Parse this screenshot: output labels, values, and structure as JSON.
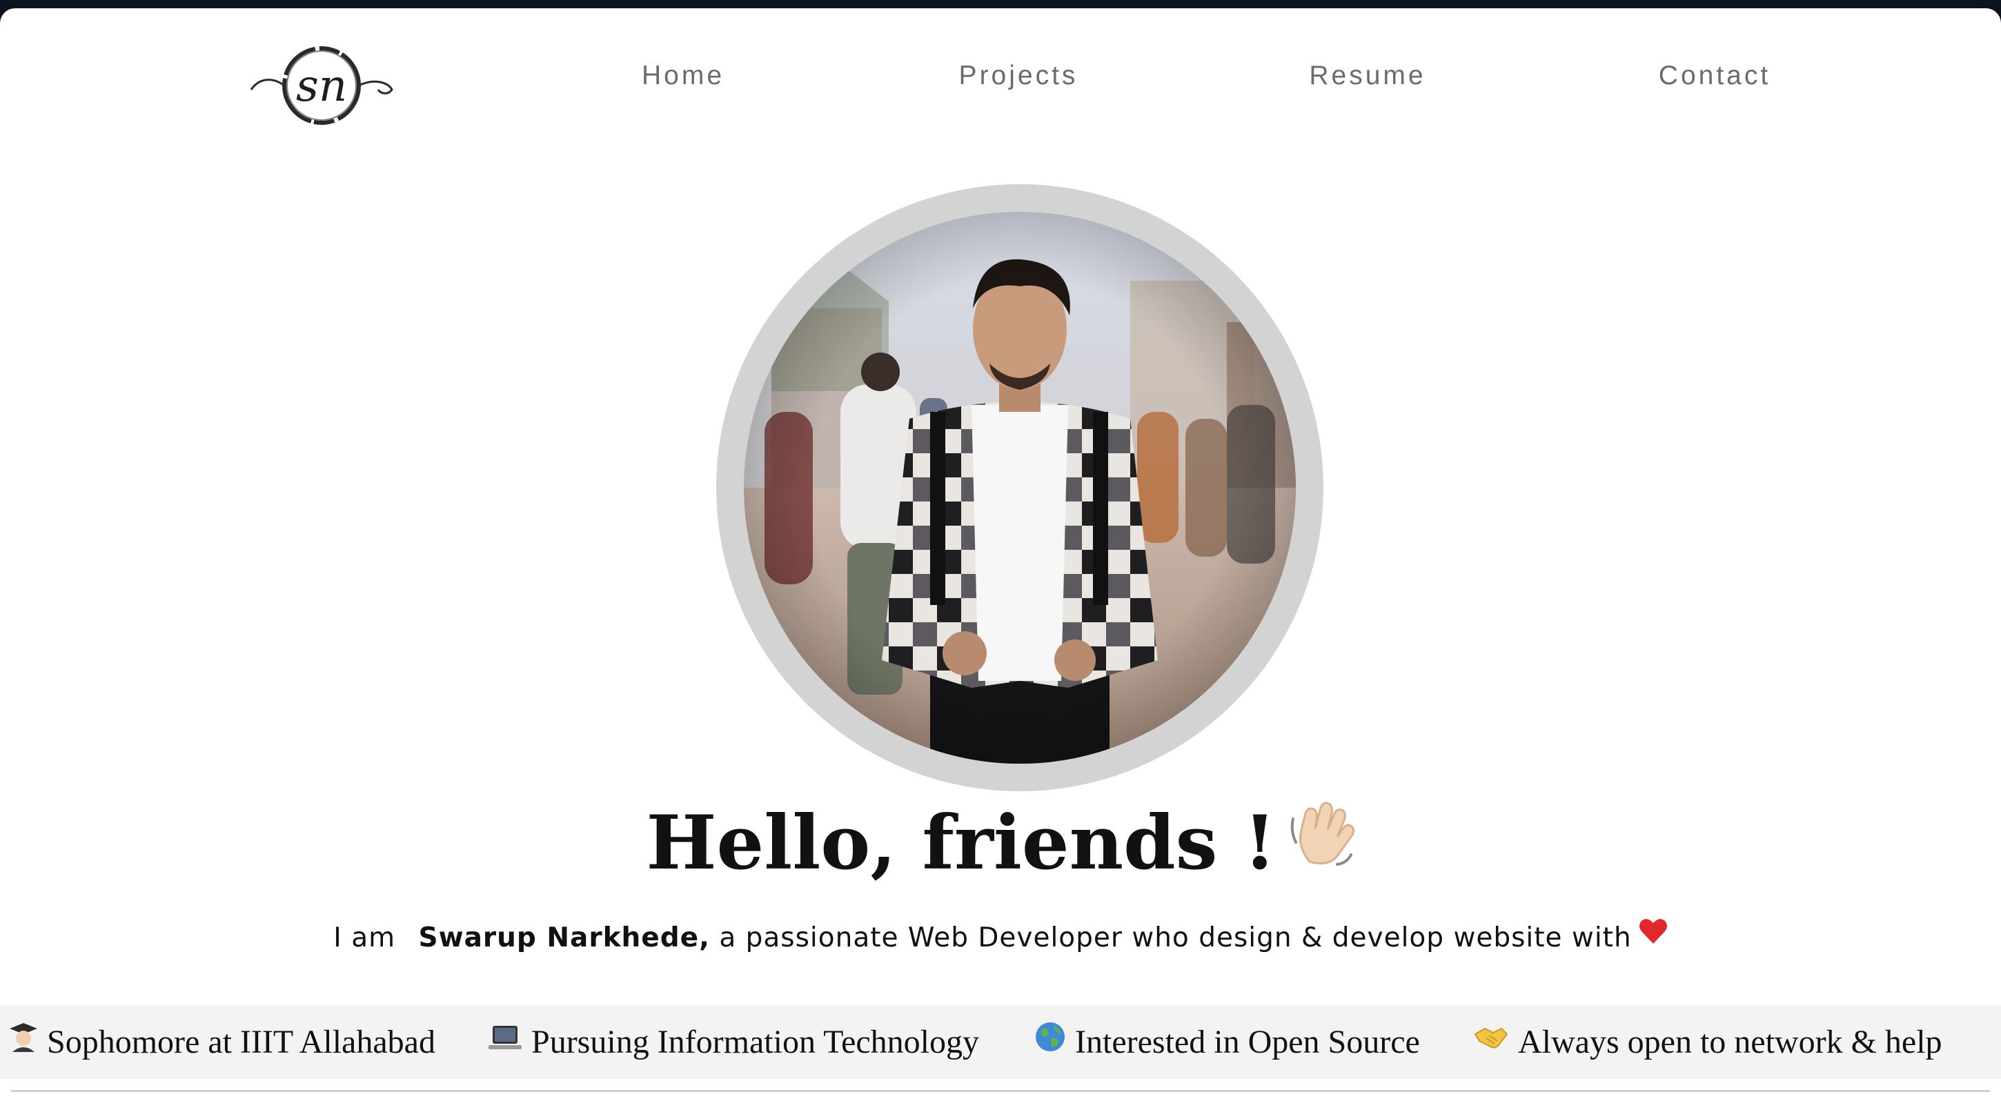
{
  "logo": {
    "text": "sn"
  },
  "nav": {
    "home": "Home",
    "projects": "Projects",
    "resume": "Resume",
    "contact": "Contact"
  },
  "hero": {
    "portrait_icon": "profile-photo",
    "title": "Hello, friends !",
    "title_icon": "waving-hand-icon",
    "intro_prefix": "I am ",
    "intro_name": "Swarup Narkhede,",
    "intro_suffix": " a passionate Web Developer who design & develop website with",
    "intro_icon": "red-heart-icon"
  },
  "ticker": {
    "items": [
      {
        "icon": "student-icon",
        "text": "Sophomore at IIIT Allahabad"
      },
      {
        "icon": "laptop-icon",
        "text": "Pursuing Information Technology"
      },
      {
        "icon": "globe-icon",
        "text": "Interested in Open Source"
      },
      {
        "icon": "handshake-icon",
        "text": "Always open to network & help"
      }
    ]
  },
  "colors": {
    "nav_text": "#6b6b6b",
    "ring": "#d3d3d3",
    "ticker_bg": "#f3f3f3",
    "heart": "#e0282e"
  }
}
